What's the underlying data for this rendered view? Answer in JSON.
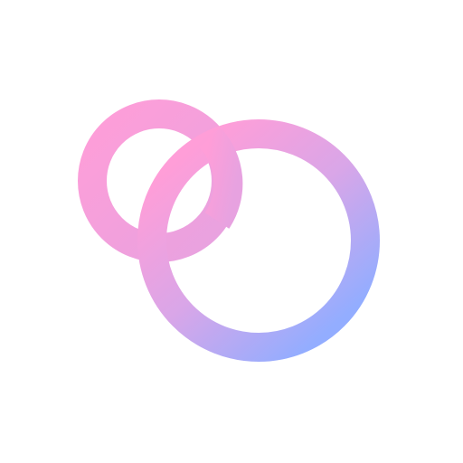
{
  "logo": {
    "icon": "interlocking-rings-logo",
    "colors": {
      "gradient_start": "#ff9ed8",
      "gradient_mid": "#d9a6e8",
      "gradient_end": "#93adff",
      "background": "#ffffff"
    }
  }
}
